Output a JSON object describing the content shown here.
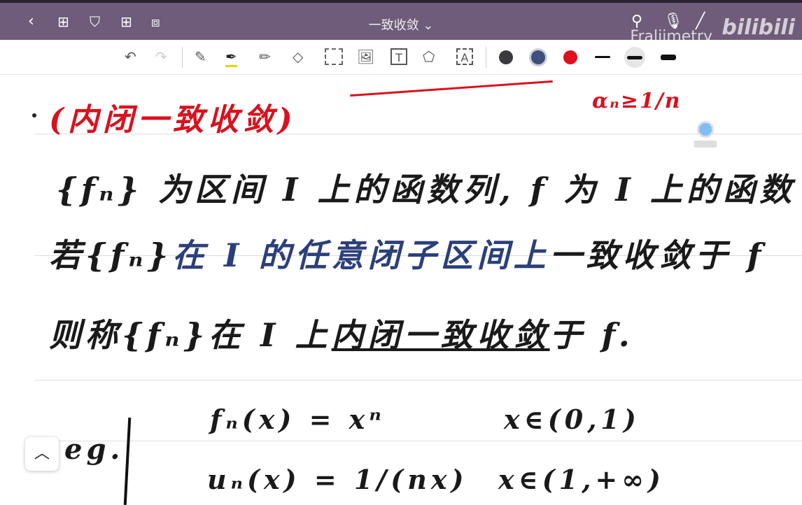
{
  "header": {
    "title": "一致收敛",
    "watermark": "Fraljimetry",
    "logo": "bilibili"
  },
  "toolbar": {
    "colors": [
      "#3a3a3e",
      "#3d4f7a",
      "#e0101e"
    ]
  },
  "note": {
    "heading": "(内闭一致收敛)",
    "margin_note": "αₙ≥1/n",
    "line1": "{fₙ} 为区间 I 上的函数列, f 为 I 上的函数",
    "line2_a": "若{fₙ}",
    "line2_b": "在 I 的任意闭子区间上",
    "line2_c": "一致收敛于 f",
    "line3_a": "则称{fₙ}在 I 上",
    "line3_b": "内闭一致收敛",
    "line3_c": "于 f.",
    "eg": "eg.",
    "ex1_fn": "fₙ(x) = xⁿ",
    "ex1_dom": "x∈(0,1)",
    "ex2_fn": "uₙ(x) = 1/(nx)",
    "ex2_dom": "x∈(1,+∞)"
  }
}
